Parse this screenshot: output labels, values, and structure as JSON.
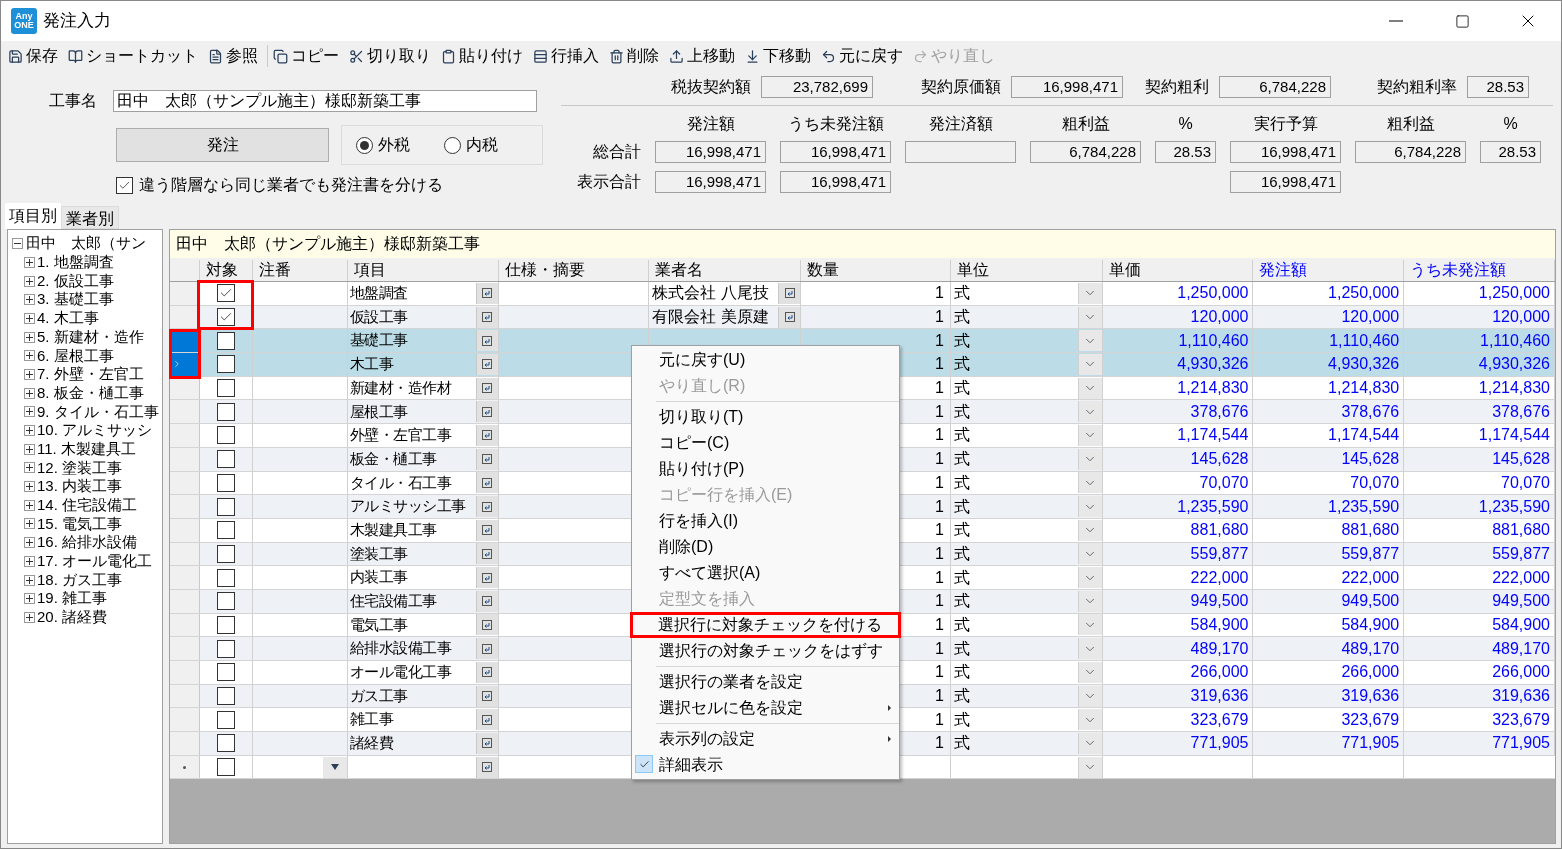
{
  "window": {
    "logo": "Any ONE",
    "title": "発注入力"
  },
  "toolbar": [
    {
      "label": "保存",
      "disabled": false
    },
    {
      "label": "ショートカット",
      "disabled": false
    },
    {
      "label": "参照",
      "disabled": false
    },
    {
      "label": "コピー",
      "disabled": false
    },
    {
      "label": "切り取り",
      "disabled": false
    },
    {
      "label": "貼り付け",
      "disabled": false
    },
    {
      "label": "行挿入",
      "disabled": false
    },
    {
      "label": "削除",
      "disabled": false
    },
    {
      "label": "上移動",
      "disabled": false
    },
    {
      "label": "下移動",
      "disabled": false
    },
    {
      "label": "元に戻す",
      "disabled": false
    },
    {
      "label": "やり直し",
      "disabled": true
    }
  ],
  "form": {
    "project_label": "工事名",
    "project_name": "田中　太郎（サンプル施主）様邸新築工事",
    "order_button": "発注",
    "tax_options": [
      {
        "label": "外税",
        "selected": true
      },
      {
        "label": "内税",
        "selected": false
      }
    ],
    "split_checkbox": {
      "label": "違う階層なら同じ業者でも発注書を分ける",
      "checked": true
    }
  },
  "contract": [
    {
      "label": "税抜契約額",
      "value": "23,782,699"
    },
    {
      "label": "契約原価額",
      "value": "16,998,471"
    },
    {
      "label": "契約粗利",
      "value": "6,784,228"
    },
    {
      "label": "契約粗利率",
      "value": "28.53"
    }
  ],
  "totals": {
    "columns": [
      "発注額",
      "うち未発注額",
      "発注済額",
      "粗利益",
      "%",
      "実行予算",
      "粗利益",
      "%"
    ],
    "rows": [
      {
        "label": "総合計",
        "cells": [
          {
            "kind": "field",
            "value": "16,998,471"
          },
          {
            "kind": "field",
            "value": "16,998,471"
          },
          {
            "kind": "field"
          },
          {
            "kind": "field",
            "value": "6,784,228"
          },
          {
            "kind": "field",
            "value": "28.53"
          },
          {
            "kind": "field",
            "value": "16,998,471"
          },
          {
            "kind": "field",
            "value": "6,784,228"
          },
          {
            "kind": "field",
            "value": "28.53"
          }
        ]
      },
      {
        "label": "表示合計",
        "cells": [
          {
            "kind": "field",
            "value": "16,998,471"
          },
          {
            "kind": "field",
            "value": "16,998,471"
          },
          {
            "kind": "none"
          },
          {
            "kind": "none"
          },
          {
            "kind": "none"
          },
          {
            "kind": "field",
            "value": "16,998,471"
          },
          {
            "kind": "none"
          },
          {
            "kind": "none"
          }
        ]
      }
    ]
  },
  "tabs": [
    {
      "label": "項目別",
      "selected": true
    },
    {
      "label": "業者別",
      "selected": false
    }
  ],
  "tree": {
    "label": "田中　太郎（サン",
    "expanded": true,
    "children": [
      {
        "label": "1. 地盤調査",
        "expanded": false
      },
      {
        "label": "2. 仮設工事",
        "expanded": false
      },
      {
        "label": "3. 基礎工事",
        "expanded": false
      },
      {
        "label": "4. 木工事",
        "expanded": false
      },
      {
        "label": "5. 新建材・造作",
        "expanded": false
      },
      {
        "label": "6. 屋根工事",
        "expanded": false
      },
      {
        "label": "7. 外壁・左官工",
        "expanded": false
      },
      {
        "label": "8. 板金・樋工事",
        "expanded": false
      },
      {
        "label": "9. タイル・石工事",
        "expanded": false
      },
      {
        "label": "10. アルミサッシ",
        "expanded": false
      },
      {
        "label": "11. 木製建具工",
        "expanded": false
      },
      {
        "label": "12. 塗装工事",
        "expanded": false
      },
      {
        "label": "13. 内装工事",
        "expanded": false
      },
      {
        "label": "14. 住宅設備工",
        "expanded": false
      },
      {
        "label": "15. 電気工事",
        "expanded": false
      },
      {
        "label": "16. 給排水設備",
        "expanded": false
      },
      {
        "label": "17. オール電化工",
        "expanded": false
      },
      {
        "label": "18. ガス工事",
        "expanded": false
      },
      {
        "label": "19. 雑工事",
        "expanded": false
      },
      {
        "label": "20. 諸経費",
        "expanded": false
      }
    ]
  },
  "table": {
    "title": "田中　太郎（サンプル施主）様邸新築工事",
    "columns": [
      {
        "label": "対象",
        "computed": false
      },
      {
        "label": "注番",
        "computed": false
      },
      {
        "label": "項目",
        "computed": false
      },
      {
        "label": "仕様・摘要",
        "computed": false
      },
      {
        "label": "業者名",
        "computed": false
      },
      {
        "label": "数量",
        "computed": false
      },
      {
        "label": "単位",
        "computed": false
      },
      {
        "label": "単価",
        "computed": false
      },
      {
        "label": "発注額",
        "computed": true
      },
      {
        "label": "うち未発注額",
        "computed": true
      }
    ],
    "rows": [
      {
        "item": "地盤調査",
        "vendor": "株式会社 八尾技",
        "quantity": "1",
        "unit": "式",
        "unit_price": "1,250,000",
        "order_amount": "1,250,000",
        "unordered_amount": "1,250,000",
        "checked": true,
        "selected": false,
        "current": false,
        "checkbox_callout": true,
        "header_callout": false
      },
      {
        "item": "仮設工事",
        "vendor": "有限会社 美原建",
        "quantity": "1",
        "unit": "式",
        "unit_price": "120,000",
        "order_amount": "120,000",
        "unordered_amount": "120,000",
        "checked": true,
        "selected": false,
        "current": false,
        "checkbox_callout": true,
        "header_callout": false
      },
      {
        "item": "基礎工事",
        "quantity": "1",
        "unit": "式",
        "unit_price": "1,110,460",
        "order_amount": "1,110,460",
        "unordered_amount": "1,110,460",
        "checked": false,
        "selected": true,
        "current": false,
        "checkbox_callout": false,
        "header_callout": true
      },
      {
        "item": "木工事",
        "quantity": "1",
        "unit": "式",
        "unit_price": "4,930,326",
        "order_amount": "4,930,326",
        "unordered_amount": "4,930,326",
        "checked": false,
        "selected": true,
        "current": true,
        "checkbox_callout": false,
        "header_callout": true
      },
      {
        "item": "新建材・造作材",
        "quantity": "1",
        "unit": "式",
        "unit_price": "1,214,830",
        "order_amount": "1,214,830",
        "unordered_amount": "1,214,830",
        "checked": false,
        "selected": false,
        "current": false,
        "checkbox_callout": false,
        "header_callout": false
      },
      {
        "item": "屋根工事",
        "quantity": "1",
        "unit": "式",
        "unit_price": "378,676",
        "order_amount": "378,676",
        "unordered_amount": "378,676",
        "checked": false,
        "selected": false,
        "current": false,
        "checkbox_callout": false,
        "header_callout": false
      },
      {
        "item": "外壁・左官工事",
        "quantity": "1",
        "unit": "式",
        "unit_price": "1,174,544",
        "order_amount": "1,174,544",
        "unordered_amount": "1,174,544",
        "checked": false,
        "selected": false,
        "current": false,
        "checkbox_callout": false,
        "header_callout": false
      },
      {
        "item": "板金・樋工事",
        "quantity": "1",
        "unit": "式",
        "unit_price": "145,628",
        "order_amount": "145,628",
        "unordered_amount": "145,628",
        "checked": false,
        "selected": false,
        "current": false,
        "checkbox_callout": false,
        "header_callout": false
      },
      {
        "item": "タイル・石工事",
        "quantity": "1",
        "unit": "式",
        "unit_price": "70,070",
        "order_amount": "70,070",
        "unordered_amount": "70,070",
        "checked": false,
        "selected": false,
        "current": false,
        "checkbox_callout": false,
        "header_callout": false
      },
      {
        "item": "アルミサッシ工事",
        "quantity": "1",
        "unit": "式",
        "unit_price": "1,235,590",
        "order_amount": "1,235,590",
        "unordered_amount": "1,235,590",
        "checked": false,
        "selected": false,
        "current": false,
        "checkbox_callout": false,
        "header_callout": false
      },
      {
        "item": "木製建具工事",
        "quantity": "1",
        "unit": "式",
        "unit_price": "881,680",
        "order_amount": "881,680",
        "unordered_amount": "881,680",
        "checked": false,
        "selected": false,
        "current": false,
        "checkbox_callout": false,
        "header_callout": false
      },
      {
        "item": "塗装工事",
        "quantity": "1",
        "unit": "式",
        "unit_price": "559,877",
        "order_amount": "559,877",
        "unordered_amount": "559,877",
        "checked": false,
        "selected": false,
        "current": false,
        "checkbox_callout": false,
        "header_callout": false
      },
      {
        "item": "内装工事",
        "quantity": "1",
        "unit": "式",
        "unit_price": "222,000",
        "order_amount": "222,000",
        "unordered_amount": "222,000",
        "checked": false,
        "selected": false,
        "current": false,
        "checkbox_callout": false,
        "header_callout": false
      },
      {
        "item": "住宅設備工事",
        "quantity": "1",
        "unit": "式",
        "unit_price": "949,500",
        "order_amount": "949,500",
        "unordered_amount": "949,500",
        "checked": false,
        "selected": false,
        "current": false,
        "checkbox_callout": false,
        "header_callout": false
      },
      {
        "item": "電気工事",
        "quantity": "1",
        "unit": "式",
        "unit_price": "584,900",
        "order_amount": "584,900",
        "unordered_amount": "584,900",
        "checked": false,
        "selected": false,
        "current": false,
        "checkbox_callout": false,
        "header_callout": false
      },
      {
        "item": "給排水設備工事",
        "quantity": "1",
        "unit": "式",
        "unit_price": "489,170",
        "order_amount": "489,170",
        "unordered_amount": "489,170",
        "checked": false,
        "selected": false,
        "current": false,
        "checkbox_callout": false,
        "header_callout": false
      },
      {
        "item": "オール電化工事",
        "quantity": "1",
        "unit": "式",
        "unit_price": "266,000",
        "order_amount": "266,000",
        "unordered_amount": "266,000",
        "checked": false,
        "selected": false,
        "current": false,
        "checkbox_callout": false,
        "header_callout": false
      },
      {
        "item": "ガス工事",
        "quantity": "1",
        "unit": "式",
        "unit_price": "319,636",
        "order_amount": "319,636",
        "unordered_amount": "319,636",
        "checked": false,
        "selected": false,
        "current": false,
        "checkbox_callout": false,
        "header_callout": false
      },
      {
        "item": "雑工事",
        "quantity": "1",
        "unit": "式",
        "unit_price": "323,679",
        "order_amount": "323,679",
        "unordered_amount": "323,679",
        "checked": false,
        "selected": false,
        "current": false,
        "checkbox_callout": false,
        "header_callout": false
      },
      {
        "item": "諸経費",
        "quantity": "1",
        "unit": "式",
        "unit_price": "771,905",
        "order_amount": "771,905",
        "unordered_amount": "771,905",
        "checked": false,
        "selected": false,
        "current": false,
        "checkbox_callout": false,
        "header_callout": false
      }
    ],
    "new_row": {
      "checked": false
    }
  },
  "context_menu": [
    {
      "kind": "item",
      "label": "元に戻す(U)",
      "disabled": false
    },
    {
      "kind": "item",
      "label": "やり直し(R)",
      "disabled": true
    },
    {
      "kind": "separator"
    },
    {
      "kind": "item",
      "label": "切り取り(T)",
      "disabled": false
    },
    {
      "kind": "item",
      "label": "コピー(C)",
      "disabled": false
    },
    {
      "kind": "item",
      "label": "貼り付け(P)",
      "disabled": false
    },
    {
      "kind": "item",
      "label": "コピー行を挿入(E)",
      "disabled": true
    },
    {
      "kind": "item",
      "label": "行を挿入(I)",
      "disabled": false
    },
    {
      "kind": "item",
      "label": "削除(D)",
      "disabled": false
    },
    {
      "kind": "item",
      "label": "すべて選択(A)",
      "disabled": false
    },
    {
      "kind": "item",
      "label": "定型文を挿入",
      "disabled": true
    },
    {
      "kind": "item",
      "label": "選択行に対象チェックを付ける",
      "disabled": false,
      "callout": true
    },
    {
      "kind": "item",
      "label": "選択行の対象チェックをはずす",
      "disabled": false
    },
    {
      "kind": "separator"
    },
    {
      "kind": "item",
      "label": "選択行の業者を設定",
      "disabled": false
    },
    {
      "kind": "submenu",
      "label": "選択セルに色を設定",
      "disabled": false
    },
    {
      "kind": "separator"
    },
    {
      "kind": "submenu",
      "label": "表示列の設定",
      "disabled": false
    },
    {
      "kind": "item",
      "label": "詳細表示",
      "disabled": false,
      "checked": true
    }
  ]
}
